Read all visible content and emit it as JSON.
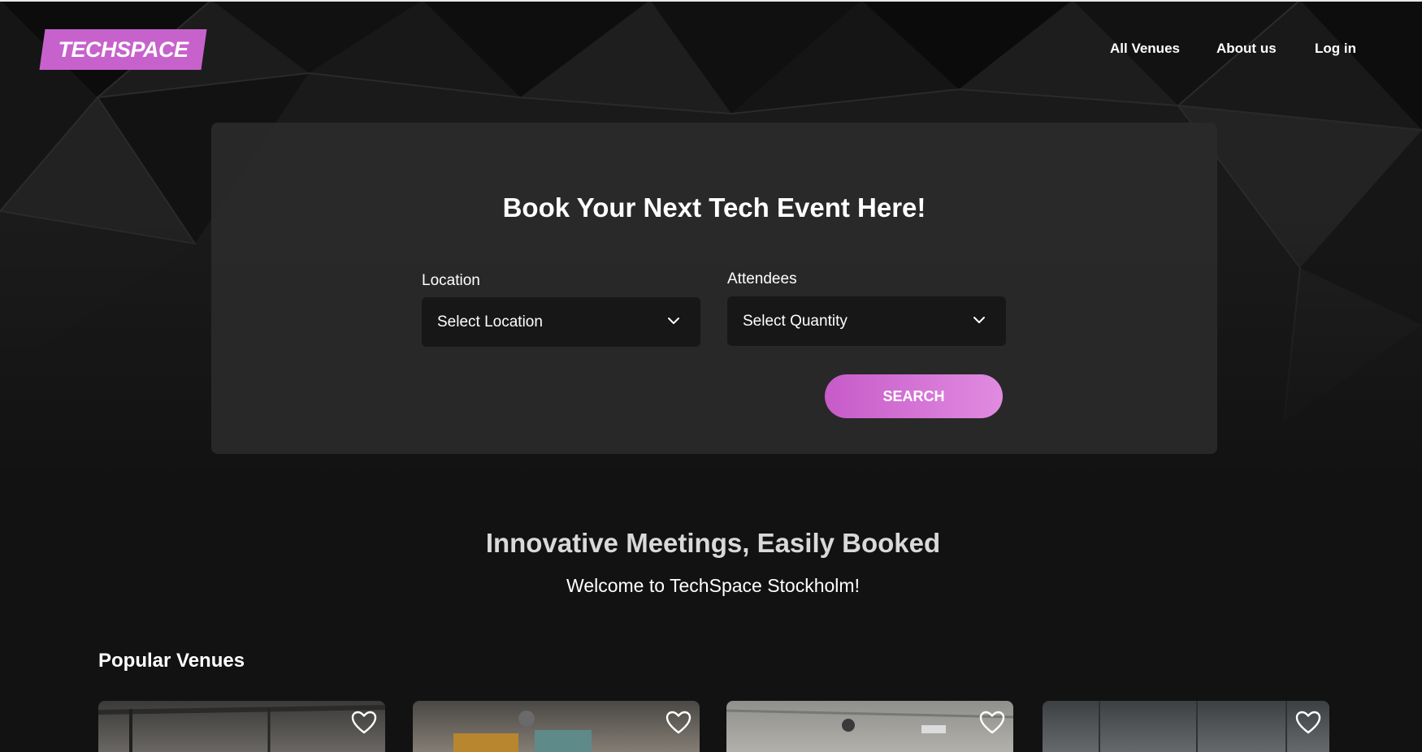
{
  "brand": {
    "logo_text": "TECHSPACE",
    "accent": "#c762cc"
  },
  "nav": {
    "items": [
      "All Venues",
      "About us",
      "Log in"
    ]
  },
  "search_panel": {
    "title": "Book Your Next Tech Event Here!",
    "location": {
      "label": "Location",
      "value": "Select Location",
      "icon": "chevron-down-icon"
    },
    "attendees": {
      "label": "Attendees",
      "value": "Select Quantity",
      "icon": "chevron-down-icon"
    },
    "search_label": "SEARCH"
  },
  "intro": {
    "headline": "Innovative Meetings, Easily Booked",
    "subline": "Welcome to TechSpace Stockholm!"
  },
  "popular": {
    "title": "Popular Venues",
    "cards": [
      {
        "icon": "heart-icon"
      },
      {
        "icon": "heart-icon"
      },
      {
        "icon": "heart-icon"
      },
      {
        "icon": "heart-icon"
      }
    ]
  }
}
